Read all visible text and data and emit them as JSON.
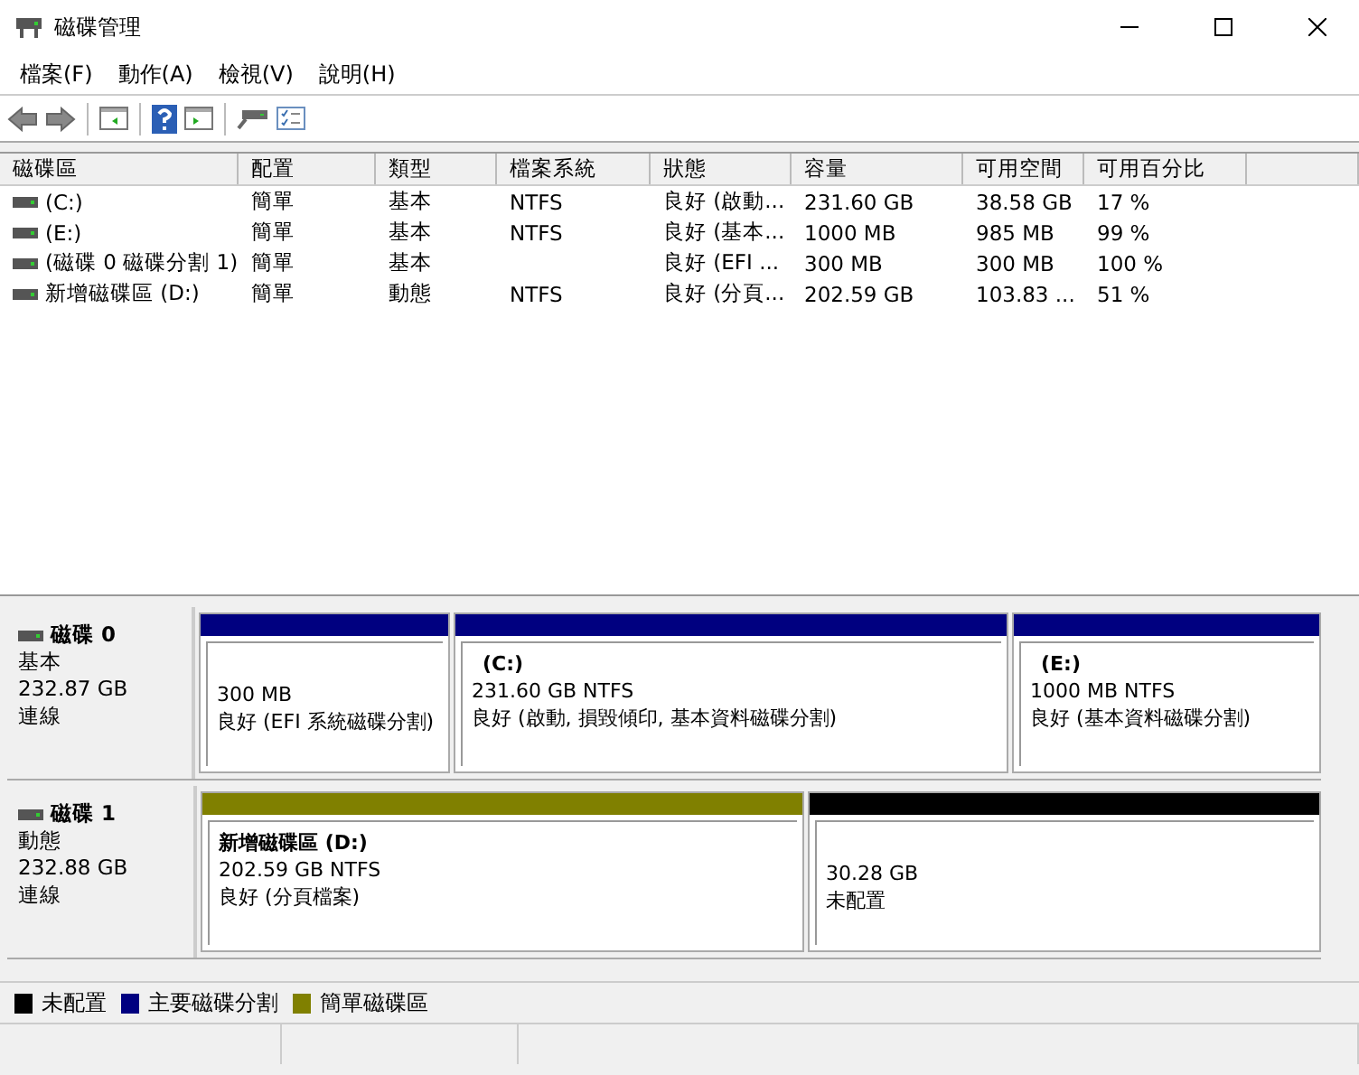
{
  "window": {
    "title": "磁碟管理"
  },
  "menu": [
    "檔案(F)",
    "動作(A)",
    "檢視(V)",
    "說明(H)"
  ],
  "volume_table": {
    "columns": [
      "磁碟區",
      "配置",
      "類型",
      "檔案系統",
      "狀態",
      "容量",
      "可用空間",
      "可用百分比"
    ],
    "rows": [
      [
        "(C:)",
        "簡單",
        "基本",
        "NTFS",
        "良好 (啟動...",
        "231.60 GB",
        "38.58 GB",
        "17 %"
      ],
      [
        "(E:)",
        "簡單",
        "基本",
        "NTFS",
        "良好 (基本...",
        "1000 MB",
        "985 MB",
        "99 %"
      ],
      [
        "(磁碟 0 磁碟分割 1)",
        "簡單",
        "基本",
        "",
        "良好 (EFI ...",
        "300 MB",
        "300 MB",
        "100 %"
      ],
      [
        "新增磁碟區 (D:)",
        "簡單",
        "動態",
        "NTFS",
        "良好 (分頁...",
        "202.59 GB",
        "103.83 ...",
        "51 %"
      ]
    ]
  },
  "disks": [
    {
      "name": "磁碟 0",
      "type": "基本",
      "size": "232.87 GB",
      "status": "連線",
      "partitions": [
        {
          "kind": "primary",
          "size": "300 MB",
          "status": "良好 (EFI 系統磁碟分割)"
        },
        {
          "kind": "primary",
          "title": "(C:)",
          "size": "231.60 GB NTFS",
          "status": "良好 (啟動, 損毀傾印, 基本資料磁碟分割)"
        },
        {
          "kind": "primary",
          "title": "(E:)",
          "size": "1000 MB NTFS",
          "status": "良好 (基本資料磁碟分割)"
        }
      ]
    },
    {
      "name": "磁碟 1",
      "type": "動態",
      "size": "232.88 GB",
      "status": "連線",
      "partitions": [
        {
          "kind": "simple",
          "title": "新增磁碟區  (D:)",
          "size": "202.59 GB NTFS",
          "status": "良好 (分頁檔案)"
        },
        {
          "kind": "unallocated",
          "size": "30.28 GB",
          "status": "未配置"
        }
      ]
    }
  ],
  "legend": [
    {
      "label": "未配置",
      "color": "#000000"
    },
    {
      "label": "主要磁碟分割",
      "color": "#000080"
    },
    {
      "label": "簡單磁碟區",
      "color": "#808000"
    }
  ]
}
